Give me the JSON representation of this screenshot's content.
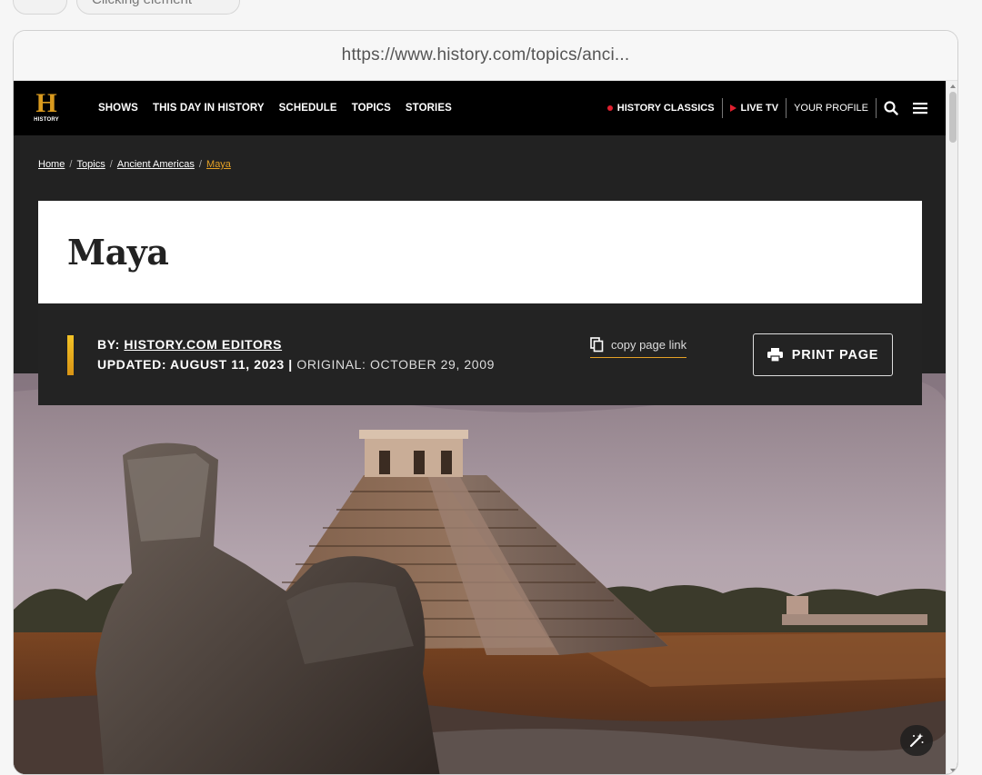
{
  "top": {
    "chip_label": "Clicking element"
  },
  "browser": {
    "url": "https://www.history.com/topics/anci..."
  },
  "nav": {
    "logo_letter": "H",
    "logo_text": "HISTORY",
    "links": [
      "SHOWS",
      "THIS DAY IN HISTORY",
      "SCHEDULE",
      "TOPICS",
      "STORIES"
    ],
    "classics": "HISTORY CLASSICS",
    "live_tv": "LIVE TV",
    "profile": "YOUR PROFILE"
  },
  "breadcrumb": {
    "home": "Home",
    "topics": "Topics",
    "section": "Ancient Americas",
    "current": "Maya"
  },
  "article": {
    "title": "Maya",
    "by_label": "BY:",
    "author": "HISTORY.COM EDITORS",
    "updated_label": "UPDATED: AUGUST 11, 2023",
    "separator": "|",
    "original_label": "ORIGINAL: OCTOBER 29, 2009",
    "copy_link": "copy page link",
    "print": "PRINT PAGE"
  },
  "colors": {
    "accent": "#e5a126",
    "live_red": "#e0202f",
    "nav_bg": "#000000",
    "bar_bg": "#232323"
  },
  "icons": [
    "search-icon",
    "menu-icon",
    "copy-icon",
    "printer-icon",
    "magic-wand-icon"
  ]
}
